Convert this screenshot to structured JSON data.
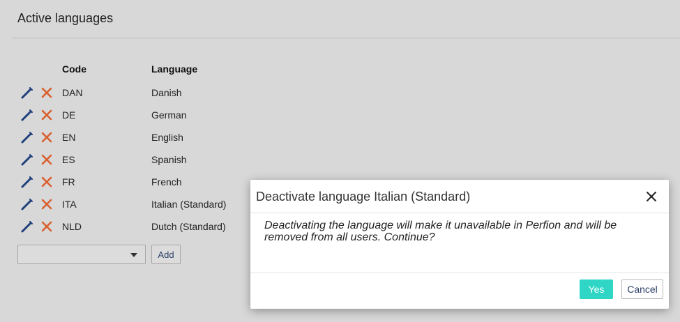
{
  "page": {
    "title": "Active languages"
  },
  "table": {
    "headers": {
      "code": "Code",
      "language": "Language"
    },
    "rows": [
      {
        "code": "DAN",
        "language": "Danish"
      },
      {
        "code": "DE",
        "language": "German"
      },
      {
        "code": "EN",
        "language": "English"
      },
      {
        "code": "ES",
        "language": "Spanish"
      },
      {
        "code": "FR",
        "language": "French"
      },
      {
        "code": "ITA",
        "language": "Italian (Standard)"
      },
      {
        "code": "NLD",
        "language": "Dutch (Standard)"
      }
    ],
    "row_icons": {
      "edit": "pencil-icon",
      "delete": "close-x-icon"
    }
  },
  "add_form": {
    "select_value": "",
    "add_label": "Add"
  },
  "dialog": {
    "title": "Deactivate language Italian (Standard)",
    "message": "Deactivating the language will make it unavailable in Perfion and will be removed from all users. Continue?",
    "yes_label": "Yes",
    "cancel_label": "Cancel"
  },
  "colors": {
    "background": "#d8d8d8",
    "edit_icon": "#1f3f7a",
    "delete_icon": "#d9602e",
    "yes_button": "#2fd6c6"
  }
}
